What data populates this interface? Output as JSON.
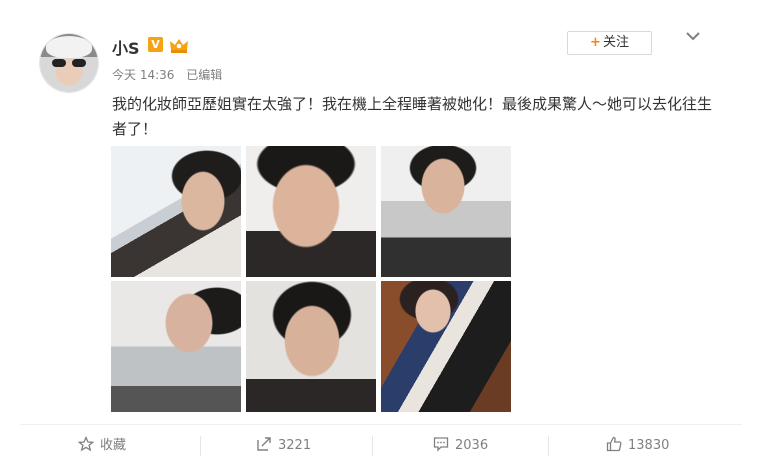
{
  "post": {
    "author": "小S",
    "verified_badge": "V",
    "time": "今天 14:36",
    "edited": "已编辑",
    "text": "我的化妝師亞歷姐實在太強了！我在機上全程睡著被她化！最後成果驚人～她可以去化往生者了！"
  },
  "header": {
    "follow_plus": "+",
    "follow_label": "关注"
  },
  "photos": [
    {
      "icon": "photo-1"
    },
    {
      "icon": "photo-2"
    },
    {
      "icon": "photo-3"
    },
    {
      "icon": "photo-4"
    },
    {
      "icon": "photo-5"
    },
    {
      "icon": "photo-6"
    }
  ],
  "footer": {
    "favorite_label": "收藏",
    "repost_count": "3221",
    "comment_count": "2036",
    "like_count": "13830"
  },
  "colors": {
    "accent": "#ff8200",
    "vip_badge": "#f6a212",
    "muted": "#808080"
  }
}
